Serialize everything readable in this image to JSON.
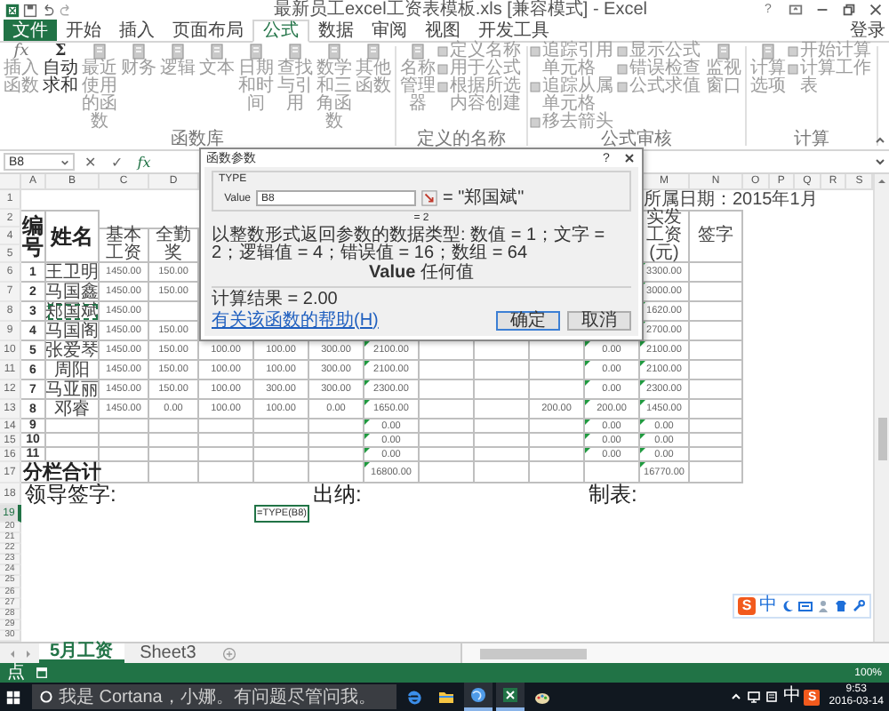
{
  "window": {
    "title": "最新员工excel工资表模板.xls [兼容模式] - Excel",
    "help": "?"
  },
  "tabs": [
    {
      "label": "文件",
      "kind": "file",
      "selected": false
    },
    {
      "label": "开始",
      "kind": "tab",
      "selected": false
    },
    {
      "label": "插入",
      "kind": "tab",
      "selected": false
    },
    {
      "label": "页面布局",
      "kind": "tab",
      "selected": false
    },
    {
      "label": "公式",
      "kind": "tab",
      "selected": true
    },
    {
      "label": "数据",
      "kind": "tab",
      "selected": false
    },
    {
      "label": "审阅",
      "kind": "tab",
      "selected": false
    },
    {
      "label": "视图",
      "kind": "tab",
      "selected": false
    },
    {
      "label": "开发工具",
      "kind": "tab",
      "selected": false
    }
  ],
  "sign_in": "登录",
  "ribbon": {
    "groups": [
      {
        "label": "函数库",
        "items": [
          {
            "kind": "large",
            "label": "插入函数",
            "glyph": "fx",
            "disabled": true
          },
          {
            "kind": "large",
            "label": "自动求和",
            "glyph": "Σ",
            "disabled": false
          },
          {
            "kind": "large",
            "label": "最近使用的函数",
            "disabled": true
          },
          {
            "kind": "large",
            "label": "财务",
            "disabled": true
          },
          {
            "kind": "large",
            "label": "逻辑",
            "disabled": true
          },
          {
            "kind": "large",
            "label": "文本",
            "disabled": true
          },
          {
            "kind": "large",
            "label": "日期和时间",
            "disabled": true
          },
          {
            "kind": "large",
            "label": "查找与引用",
            "disabled": true
          },
          {
            "kind": "large",
            "label": "数学和三角函数",
            "disabled": true
          },
          {
            "kind": "large",
            "label": "其他函数",
            "disabled": true
          }
        ]
      },
      {
        "label": "定义的名称",
        "items": [
          {
            "kind": "large",
            "label": "名称管理器",
            "disabled": true
          },
          {
            "kind": "stack",
            "items": [
              {
                "label": "定义名称",
                "disabled": true
              },
              {
                "label": "用于公式",
                "disabled": true
              },
              {
                "label": "根据所选内容创建",
                "disabled": true
              }
            ]
          }
        ]
      },
      {
        "label": "公式审核",
        "items": [
          {
            "kind": "stack",
            "items": [
              {
                "label": "追踪引用单元格",
                "disabled": true
              },
              {
                "label": "追踪从属单元格",
                "disabled": true
              },
              {
                "label": "移去箭头",
                "disabled": true
              }
            ]
          },
          {
            "kind": "stack",
            "items": [
              {
                "label": "显示公式",
                "disabled": true
              },
              {
                "label": "错误检查",
                "disabled": true
              },
              {
                "label": "公式求值",
                "disabled": true
              }
            ]
          },
          {
            "kind": "large",
            "label": "监视窗口",
            "disabled": true
          }
        ]
      },
      {
        "label": "计算",
        "items": [
          {
            "kind": "large",
            "label": "计算选项",
            "disabled": true
          },
          {
            "kind": "stack",
            "items": [
              {
                "label": "开始计算",
                "disabled": true
              },
              {
                "label": "计算工作表",
                "disabled": true
              }
            ]
          }
        ]
      }
    ]
  },
  "formula_bar": {
    "name_box": "B8",
    "cancel": "✕",
    "enter": "✓",
    "fx": "fx"
  },
  "dialog": {
    "title": "函数参数",
    "help": "?",
    "function": "TYPE",
    "argument": {
      "label": "Value",
      "value": "B8",
      "result": "= \"郑国斌\""
    },
    "result": "= 2",
    "description": "以整数形式返回参数的数据类型: 数值 = 1；文字 = 2；逻辑值 = 4；错误值 = 16；数组 = 64",
    "argument_help": "**Value**   任何值",
    "computed": "计算结果 =  2.00",
    "help_link": "有关该函数的帮助(H)",
    "buttons": [
      {
        "label": "确定",
        "default": true
      },
      {
        "label": "取消",
        "default": false
      }
    ]
  },
  "sheet": {
    "column_letters": [
      "A",
      "B",
      "C",
      "D",
      "M",
      "N",
      "O",
      "P",
      "Q",
      "R",
      "S"
    ],
    "row1": {
      "num": "1",
      "text": "所属日期：2015年1月"
    },
    "header": {
      "nums": [
        "2",
        "4",
        "5"
      ],
      "cells": {
        "A": "编号",
        "B": "姓名",
        "C": "基本工资",
        "D": "全勤奖",
        "M": "实发工资(元)",
        "N": "签字"
      }
    },
    "rows": [
      {
        "num": "6",
        "referenced": false,
        "cells": {
          "A": {
            "text": "1",
            "flag": false
          },
          "B": {
            "text": "王卫明",
            "flag": false
          },
          "C": {
            "text": "1450.00",
            "flag": false
          },
          "D": {
            "text": "150.00",
            "flag": false
          },
          "M": {
            "text": "3300.00",
            "flag": true
          }
        }
      },
      {
        "num": "7",
        "referenced": false,
        "cells": {
          "A": {
            "text": "2",
            "flag": false
          },
          "B": {
            "text": "马国鑫",
            "flag": false
          },
          "C": {
            "text": "1450.00",
            "flag": false
          },
          "D": {
            "text": "150.00",
            "flag": false
          },
          "M": {
            "text": "3000.00",
            "flag": true
          }
        }
      },
      {
        "num": "8",
        "referenced": true,
        "cells": {
          "A": {
            "text": "3",
            "flag": false
          },
          "B": {
            "text": "郑国斌",
            "flag": false
          },
          "C": {
            "text": "1450.00",
            "flag": false
          },
          "M": {
            "text": "1620.00",
            "flag": true
          }
        }
      },
      {
        "num": "9",
        "referenced": false,
        "cells": {
          "A": {
            "text": "4",
            "flag": false
          },
          "B": {
            "text": "马国阁",
            "flag": false
          },
          "C": {
            "text": "1450.00",
            "flag": false
          },
          "D": {
            "text": "150.00",
            "flag": false
          },
          "M": {
            "text": "2700.00",
            "flag": true
          }
        }
      },
      {
        "num": "10",
        "referenced": false,
        "cells": {
          "A": {
            "text": "5",
            "flag": false
          },
          "B": {
            "text": "张爱琴",
            "flag": false
          },
          "C": {
            "text": "1450.00",
            "flag": false
          },
          "D": {
            "text": "150.00",
            "flag": false
          },
          "E": {
            "text": "100.00",
            "flag": false
          },
          "F": {
            "text": "100.00",
            "flag": false
          },
          "G": {
            "text": "300.00",
            "flag": false
          },
          "H": {
            "text": "2100.00",
            "flag": true
          },
          "L": {
            "text": "0.00",
            "flag": true
          },
          "M": {
            "text": "2100.00",
            "flag": true
          }
        }
      },
      {
        "num": "11",
        "referenced": false,
        "cells": {
          "A": {
            "text": "6",
            "flag": false
          },
          "B": {
            "text": "周阳",
            "flag": false
          },
          "C": {
            "text": "1450.00",
            "flag": false
          },
          "D": {
            "text": "150.00",
            "flag": false
          },
          "E": {
            "text": "100.00",
            "flag": false
          },
          "F": {
            "text": "100.00",
            "flag": false
          },
          "G": {
            "text": "300.00",
            "flag": false
          },
          "H": {
            "text": "2100.00",
            "flag": true
          },
          "L": {
            "text": "0.00",
            "flag": true
          },
          "M": {
            "text": "2100.00",
            "flag": true
          }
        }
      },
      {
        "num": "12",
        "referenced": false,
        "cells": {
          "A": {
            "text": "7",
            "flag": false
          },
          "B": {
            "text": "马亚丽",
            "flag": false
          },
          "C": {
            "text": "1450.00",
            "flag": false
          },
          "D": {
            "text": "150.00",
            "flag": false
          },
          "E": {
            "text": "100.00",
            "flag": false
          },
          "F": {
            "text": "300.00",
            "flag": false
          },
          "G": {
            "text": "300.00",
            "flag": false
          },
          "H": {
            "text": "2300.00",
            "flag": true
          },
          "L": {
            "text": "0.00",
            "flag": true
          },
          "M": {
            "text": "2300.00",
            "flag": true
          }
        }
      },
      {
        "num": "13",
        "referenced": false,
        "cells": {
          "A": {
            "text": "8",
            "flag": false
          },
          "B": {
            "text": "邓睿",
            "flag": false
          },
          "C": {
            "text": "1450.00",
            "flag": false
          },
          "D": {
            "text": "0.00",
            "flag": false
          },
          "E": {
            "text": "100.00",
            "flag": false
          },
          "F": {
            "text": "100.00",
            "flag": false
          },
          "G": {
            "text": "0.00",
            "flag": false
          },
          "H": {
            "text": "1650.00",
            "flag": true
          },
          "K": {
            "text": "200.00",
            "flag": false
          },
          "L": {
            "text": "200.00",
            "flag": true
          },
          "M": {
            "text": "1450.00",
            "flag": true
          }
        }
      },
      {
        "num": "14",
        "referenced": false,
        "cells": {
          "A": {
            "text": "9",
            "flag": false
          },
          "H": {
            "text": "0.00",
            "flag": true
          },
          "L": {
            "text": "0.00",
            "flag": true
          },
          "M": {
            "text": "0.00",
            "flag": true
          }
        }
      },
      {
        "num": "15",
        "referenced": false,
        "cells": {
          "A": {
            "text": "10",
            "flag": false
          },
          "H": {
            "text": "0.00",
            "flag": true
          },
          "L": {
            "text": "0.00",
            "flag": true
          },
          "M": {
            "text": "0.00",
            "flag": true
          }
        }
      },
      {
        "num": "16",
        "referenced": false,
        "cells": {
          "A": {
            "text": "11",
            "flag": false
          },
          "H": {
            "text": "0.00",
            "flag": true
          },
          "L": {
            "text": "0.00",
            "flag": true
          },
          "M": {
            "text": "0.00",
            "flag": true
          }
        }
      }
    ],
    "total": {
      "num": "17",
      "label": "分栏合计",
      "cells": {
        "H": {
          "text": "16800.00",
          "flag": true
        },
        "M": {
          "text": "16770.00",
          "flag": true
        }
      }
    },
    "signatures": {
      "num": "18",
      "cells": {
        "A": "领导签字:",
        "G": "出纳:",
        "L": "制表:"
      }
    },
    "formula_row": {
      "num": "19",
      "active": true,
      "cell": "=TYPE(B8)"
    },
    "empty_rows": [
      "20",
      "21",
      "22",
      "23",
      "24",
      "25",
      "26",
      "27",
      "28",
      "29",
      "30"
    ]
  },
  "sheet_tabs": [
    {
      "label": "5月工资",
      "selected": true
    },
    {
      "label": "Sheet3",
      "selected": false
    }
  ],
  "status_bar": {
    "mode": "点",
    "zoom": "100%"
  },
  "ime_bar": {
    "logo": "S",
    "mode": "中"
  },
  "taskbar": {
    "search": {
      "placeholder": "我是 Cortana，小娜。有问题尽管问我。"
    },
    "apps": [
      {
        "running": false
      },
      {
        "running": false
      },
      {
        "running": true
      },
      {
        "running": true
      },
      {
        "running": false
      }
    ],
    "ime": "中",
    "ime_logo": "S",
    "time": "9:53",
    "date": "2016-03-14"
  }
}
